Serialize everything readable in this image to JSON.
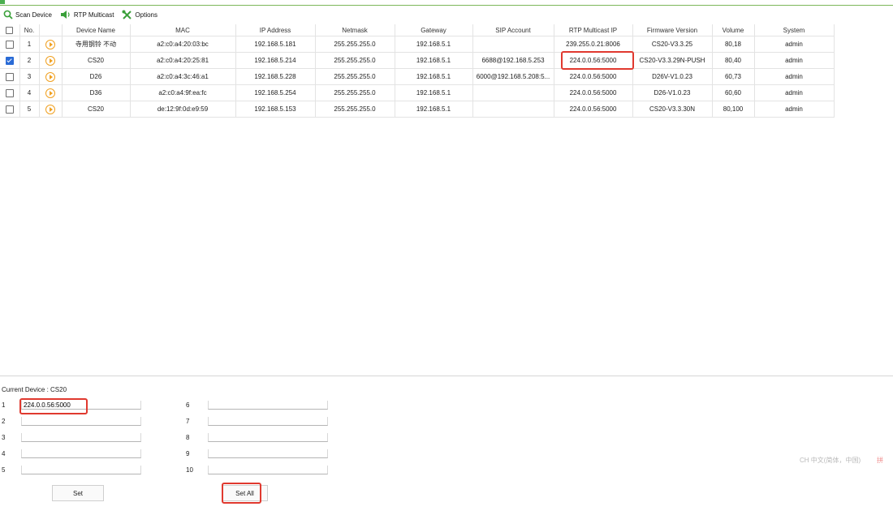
{
  "toolbar": {
    "scan_label": "Scan Device",
    "rtp_label": "RTP Multicast",
    "options_label": "Options"
  },
  "table": {
    "headers": [
      "",
      "No.",
      "",
      "Device Name",
      "MAC",
      "IP Address",
      "Netmask",
      "Gateway",
      "SIP Account",
      "RTP Multicast IP",
      "Firmware Version",
      "Volume",
      "System"
    ],
    "rows": [
      {
        "no": "1",
        "checked": false,
        "name": "寺用钢铃 不动",
        "mac": "a2:c0:a4:20:03:bc",
        "ip": "192.168.5.181",
        "mask": "255.255.255.0",
        "gw": "192.168.5.1",
        "sip": "",
        "rtp": "239.255.0.21:8006",
        "fw": "CS20-V3.3.25",
        "vol": "80,18",
        "sys": "admin"
      },
      {
        "no": "2",
        "checked": true,
        "name": "CS20",
        "mac": "a2:c0:a4:20:25:81",
        "ip": "192.168.5.214",
        "mask": "255.255.255.0",
        "gw": "192.168.5.1",
        "sip": "6688@192.168.5.253",
        "rtp": "224.0.0.56:5000",
        "fw": "CS20-V3.3.29N-PUSH",
        "vol": "80,40",
        "sys": "admin"
      },
      {
        "no": "3",
        "checked": false,
        "name": "D26",
        "mac": "a2:c0:a4:3c:46:a1",
        "ip": "192.168.5.228",
        "mask": "255.255.255.0",
        "gw": "192.168.5.1",
        "sip": "6000@192.168.5.208:5...",
        "rtp": "224.0.0.56:5000",
        "fw": "D26V-V1.0.23",
        "vol": "60,73",
        "sys": "admin"
      },
      {
        "no": "4",
        "checked": false,
        "name": "D36",
        "mac": "a2:c0:a4:9f:ea:fc",
        "ip": "192.168.5.254",
        "mask": "255.255.255.0",
        "gw": "192.168.5.1",
        "sip": "",
        "rtp": "224.0.0.56:5000",
        "fw": "D26-V1.0.23",
        "vol": "60,60",
        "sys": "admin"
      },
      {
        "no": "5",
        "checked": false,
        "name": "CS20",
        "mac": "de:12:9f:0d:e9:59",
        "ip": "192.168.5.153",
        "mask": "255.255.255.0",
        "gw": "192.168.5.1",
        "sip": "",
        "rtp": "224.0.0.56:5000",
        "fw": "CS20-V3.3.30N",
        "vol": "80,100",
        "sys": "admin"
      }
    ]
  },
  "panel": {
    "current_device": "Current Device : CS20",
    "slots": [
      {
        "label": "1",
        "value": "224.0.0.56:5000"
      },
      {
        "label": "2",
        "value": ""
      },
      {
        "label": "3",
        "value": ""
      },
      {
        "label": "4",
        "value": ""
      },
      {
        "label": "5",
        "value": ""
      },
      {
        "label": "6",
        "value": ""
      },
      {
        "label": "7",
        "value": ""
      },
      {
        "label": "8",
        "value": ""
      },
      {
        "label": "9",
        "value": ""
      },
      {
        "label": "10",
        "value": ""
      }
    ],
    "set_label": "Set",
    "set_all_label": "Set All"
  },
  "ime": {
    "text": "CH 中文(简体，中国)",
    "icon_text": "拼"
  },
  "colors": {
    "highlight": "#e0392f",
    "accent_green": "#4caf50",
    "checkbox_blue": "#2a6bd6",
    "play_orange": "#f0a020"
  }
}
